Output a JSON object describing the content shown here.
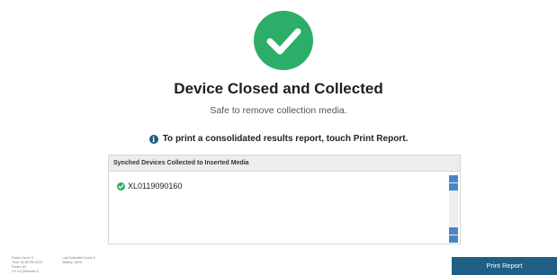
{
  "status": {
    "icon": "check-circle-icon",
    "color": "#2cae68",
    "title": "Device Closed and Collected",
    "subtitle": "Safe to remove collection media."
  },
  "info": {
    "icon": "info-icon",
    "text": "To print a consolidated results report, touch Print Report."
  },
  "panel": {
    "header": "Synched Devices Collected to Inserted Media",
    "items": [
      {
        "icon": "check-circle-icon",
        "label": "XL0119090160"
      }
    ]
  },
  "footer": {
    "col1": [
      "Public Count: 0",
      "Time: 04:35 PM 03/19",
      "Power: AC",
      "0.0.0.0 (Ethernet 1)"
    ],
    "col2": [
      "Last Collected Count: 0",
      "Battery: 100%"
    ]
  },
  "actions": {
    "print_report": "Print Report",
    "accent": "#1f5f86"
  }
}
